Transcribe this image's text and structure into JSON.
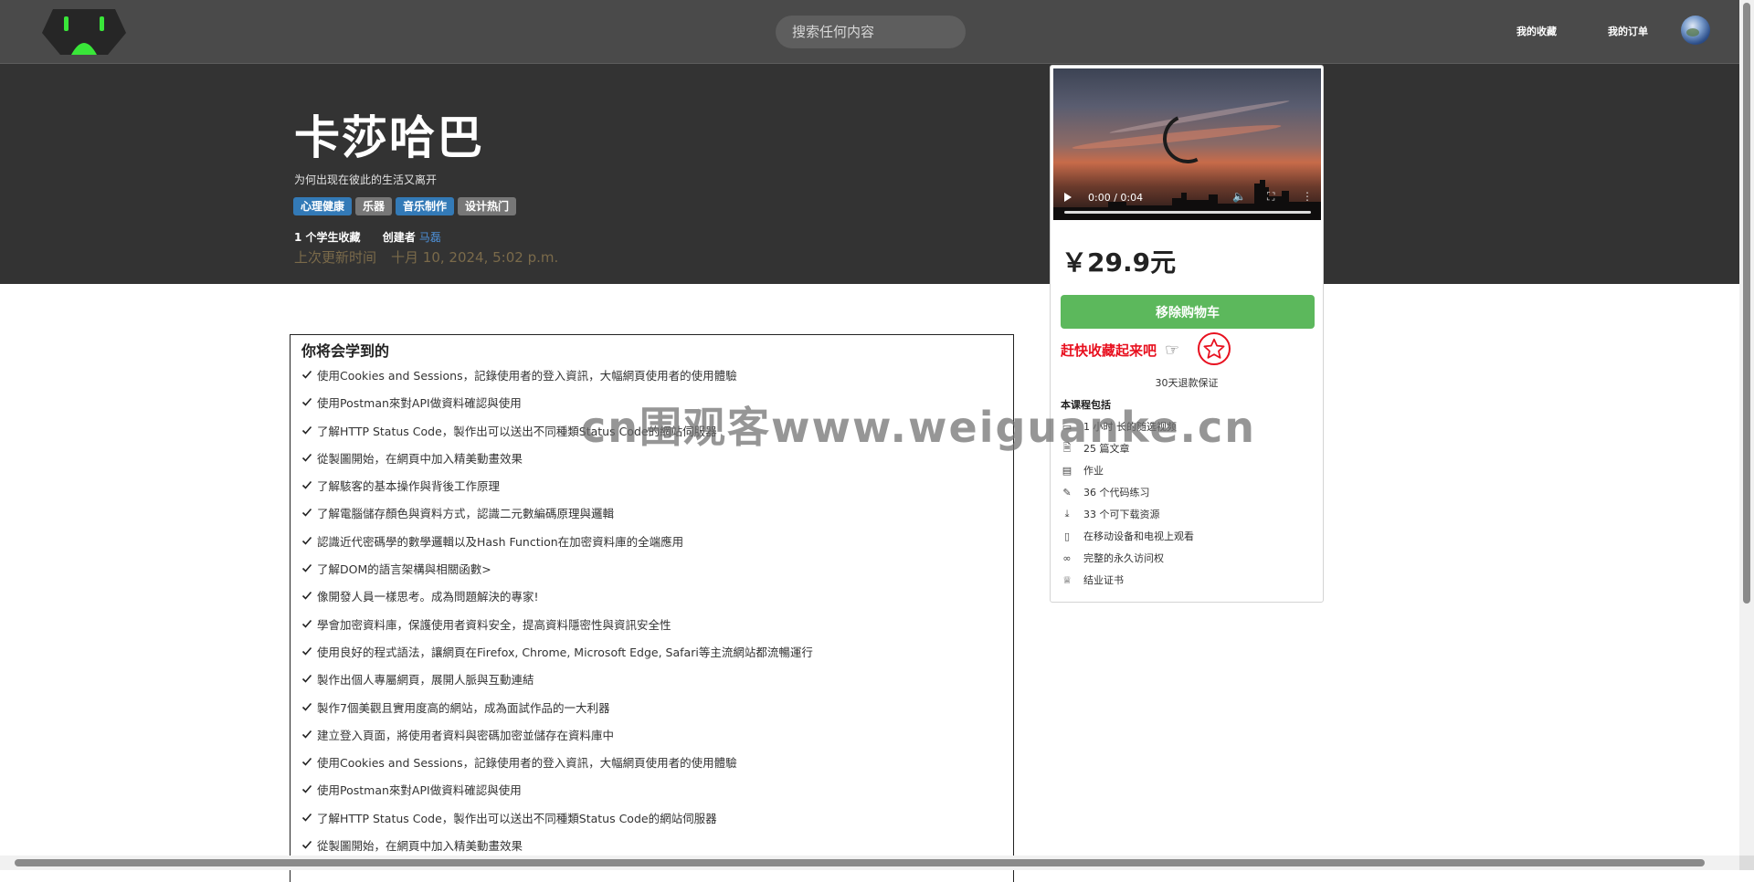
{
  "nav": {
    "search_placeholder": "搜索任何内容",
    "favorites": "我的收藏",
    "orders": "我的订单"
  },
  "course": {
    "title": "卡莎哈巴",
    "subtitle": "为何出现在彼此的生活又离开",
    "tags": [
      {
        "label": "心理健康",
        "color": "#337ab7"
      },
      {
        "label": "乐器",
        "color": "#777777"
      },
      {
        "label": "音乐制作",
        "color": "#337ab7"
      },
      {
        "label": "设计热门",
        "color": "#777777"
      }
    ],
    "students": "1 个学生收藏",
    "creator_label": "创建者",
    "creator_name": "马磊",
    "updated_label": "上次更新时间",
    "updated_value": "十月 10, 2024, 5:02 p.m."
  },
  "learn": {
    "title": "你将会学到的",
    "items": [
      "使用Cookies and Sessions，記錄使用者的登入資訊，大幅網頁使用者的使用體驗",
      "使用Postman來對API做資料確認與使用",
      "了解HTTP Status Code，製作出可以送出不同種類Status Code的網站伺服器",
      "從製圖開始，在網頁中加入精美動畫效果",
      "了解駭客的基本操作與背後工作原理",
      "了解電腦儲存顏色與資料方式，認識二元數編碼原理與邏輯",
      "認識近代密碼學的數學邏輯以及Hash Function在加密資料庫的全端應用",
      "了解DOM的語言架構與相關函數>",
      "像開發人員一樣思考。成為問題解決的專家!",
      "學會加密資料庫，保護使用者資料安全，提高資料隱密性與資訊安全性",
      "使用良好的程式語法，讓網頁在Firefox, Chrome, Microsoft Edge, Safari等主流網站都流暢運行",
      "製作出個人專屬網頁，展開人脈與互動連結",
      "製作7個美觀且實用度高的網站，成為面試作品的一大利器",
      "建立登入頁面，將使用者資料與密碼加密並儲存在資料庫中",
      "使用Cookies and Sessions，記錄使用者的登入資訊，大幅網頁使用者的使用體驗",
      "使用Postman來對API做資料確認與使用",
      "了解HTTP Status Code，製作出可以送出不同種類Status Code的網站伺服器",
      "從製圖開始，在網頁中加入精美動畫效果"
    ]
  },
  "card": {
    "video_time": "0:00 / 0:04",
    "price": "￥29.9元",
    "remove_button": "移除购物车",
    "fav_prompt": "赶快收藏起来吧",
    "guarantee": "30天退款保证",
    "includes_title": "本课程包括",
    "includes": [
      {
        "icon": "video-icon",
        "label": "1 小时 长的随选视频"
      },
      {
        "icon": "article-icon",
        "label": "25 篇文章"
      },
      {
        "icon": "assignment-icon",
        "label": "作业"
      },
      {
        "icon": "code-exercise-icon",
        "label": "36 个代码练习"
      },
      {
        "icon": "download-icon",
        "label": "33 个可下载资源"
      },
      {
        "icon": "mobile-icon",
        "label": "在移动设备和电视上观看"
      },
      {
        "icon": "infinity-icon",
        "label": "完整的永久访问权"
      },
      {
        "icon": "trophy-icon",
        "label": "结业证书"
      }
    ]
  },
  "watermark": "cn围观客www.weiguanke.cn",
  "colors": {
    "nav_bg": "#4a4a4a",
    "hero_bg": "#333333",
    "primary_tag": "#337ab7",
    "grey_tag": "#777777",
    "success": "#5cb85c",
    "accent_red": "#e8101f"
  }
}
